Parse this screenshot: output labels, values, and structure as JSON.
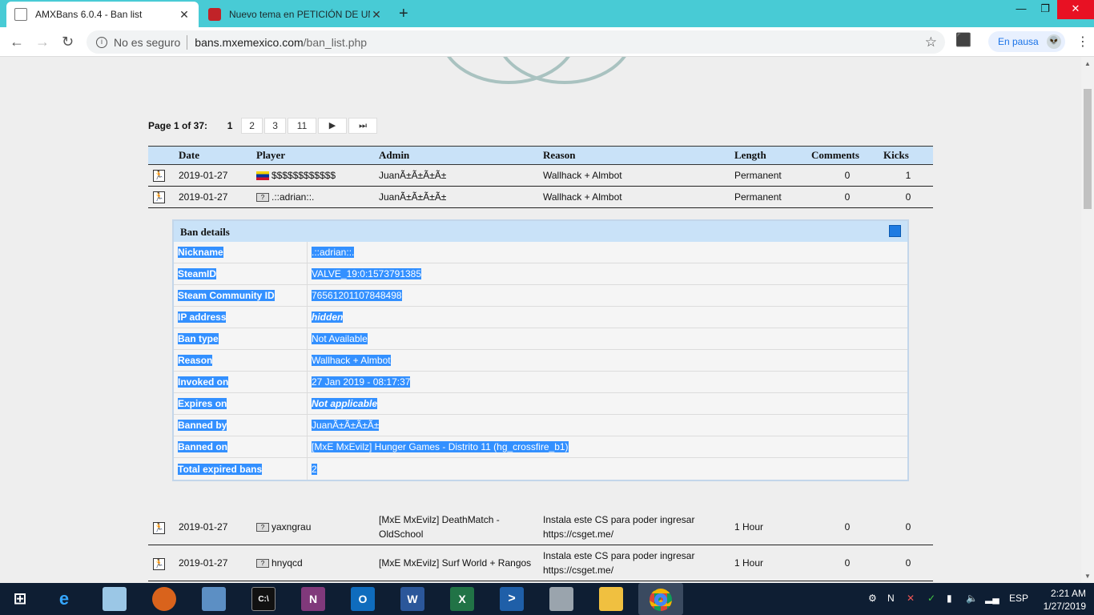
{
  "tabs": [
    {
      "title": "AMXBans 6.0.4 - Ban list",
      "active": true
    },
    {
      "title": "Nuevo tema en PETICIÓN DE UN",
      "active": false
    }
  ],
  "toolbar": {
    "security_label": "No es seguro",
    "url_host": "bans.mxemexico.com",
    "url_path": "/ban_list.php",
    "profile_label": "En pausa"
  },
  "pager": {
    "label": "Page 1 of 37:",
    "current": "1",
    "pages": [
      "2",
      "3",
      "11"
    ]
  },
  "table": {
    "headers": [
      "Date",
      "Player",
      "Admin",
      "Reason",
      "Length",
      "Comments",
      "Kicks"
    ],
    "rows": [
      {
        "date": "2019-01-27",
        "player": "$$$$$$$$$$$$",
        "flag": "ve",
        "admin": "JuanÃ±Ã±Ã±Ã±",
        "reason": "Wallhack + Almbot",
        "length": "Permanent",
        "comments": "0",
        "kicks": "1"
      },
      {
        "date": "2019-01-27",
        "player": ".::adrian::.",
        "flag": "unknown",
        "admin": "JuanÃ±Ã±Ã±Ã±",
        "reason": "Wallhack + Almbot",
        "length": "Permanent",
        "comments": "0",
        "kicks": "0"
      },
      {
        "date": "2019-01-27",
        "player": "yaxngrau",
        "flag": "unknown",
        "admin": "[MxE MxEvilz] DeathMatch - OldSchool",
        "reason": "Instala este CS para poder ingresar https://csget.me/",
        "length": "1 Hour",
        "comments": "0",
        "kicks": "0"
      },
      {
        "date": "2019-01-27",
        "player": "hnyqcd",
        "flag": "unknown",
        "admin": "[MxE MxEvilz] Surf World + Rangos",
        "reason": "Instala este CS para poder ingresar https://csget.me/",
        "length": "1 Hour",
        "comments": "0",
        "kicks": "0"
      }
    ]
  },
  "details": {
    "title": "Ban details",
    "rows": [
      {
        "key": "Nickname",
        "value": ".::adrian::.",
        "italic": false
      },
      {
        "key": "SteamID",
        "value": "VALVE_19:0:1573791385",
        "italic": false
      },
      {
        "key": "Steam Community ID",
        "value": "76561201107848498",
        "italic": false
      },
      {
        "key": "IP address",
        "value": "hidden",
        "italic": true
      },
      {
        "key": "Ban type",
        "value": "Not Available",
        "italic": false
      },
      {
        "key": "Reason",
        "value": "Wallhack + Almbot",
        "italic": false
      },
      {
        "key": "Invoked on",
        "value": "27 Jan 2019 - 08:17:37",
        "italic": false
      },
      {
        "key": "Expires on",
        "value": "Not applicable",
        "italic": true
      },
      {
        "key": "Banned by",
        "value": "JuanÃ±Ã±Ã±Ã±",
        "italic": false
      },
      {
        "key": "Banned on",
        "value": "[MxE MxEvilz] Hunger Games - Distrito 11 (hg_crossfire_b1)",
        "italic": false
      },
      {
        "key": "Total expired bans",
        "value": "2",
        "italic": false
      }
    ]
  },
  "taskbar": {
    "language": "ESP",
    "time": "2:21 AM",
    "date": "1/27/2019",
    "apps": [
      "start",
      "internet-explorer",
      "notepad",
      "fruit-app",
      "control-panel",
      "cmd",
      "onenote",
      "outlook",
      "word",
      "excel",
      "powershell",
      "calculator",
      "file-explorer",
      "chrome"
    ]
  },
  "colors": {
    "header_bg": "#c9e2f8",
    "selection": "#3390ff",
    "tabbar": "#48cbd5",
    "taskbar": "#0e1e33"
  }
}
